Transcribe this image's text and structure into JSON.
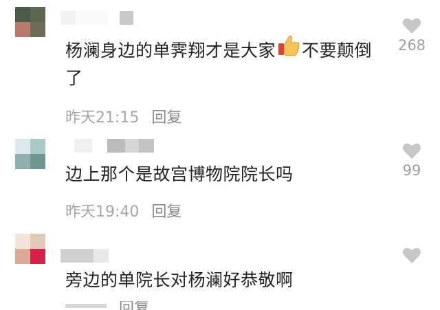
{
  "comments": [
    {
      "text_before_emoji": "杨澜身边的单霁翔才是大家",
      "emoji": "thumbs-up-icon",
      "text_after_emoji": "不要颠倒了",
      "time": "昨天21:15",
      "reply_label": "回复",
      "likes": "268"
    },
    {
      "text": "边上那个是故宫博物院院长吗",
      "time": "昨天19:40",
      "reply_label": "回复",
      "likes": "99"
    },
    {
      "text": "旁边的单院长对杨澜好恭敬啊",
      "time": "",
      "reply_label": "回复",
      "likes": ""
    }
  ],
  "colors": {
    "text": "#222222",
    "meta": "#a6a6a6",
    "heart": "#c8c8c8"
  }
}
